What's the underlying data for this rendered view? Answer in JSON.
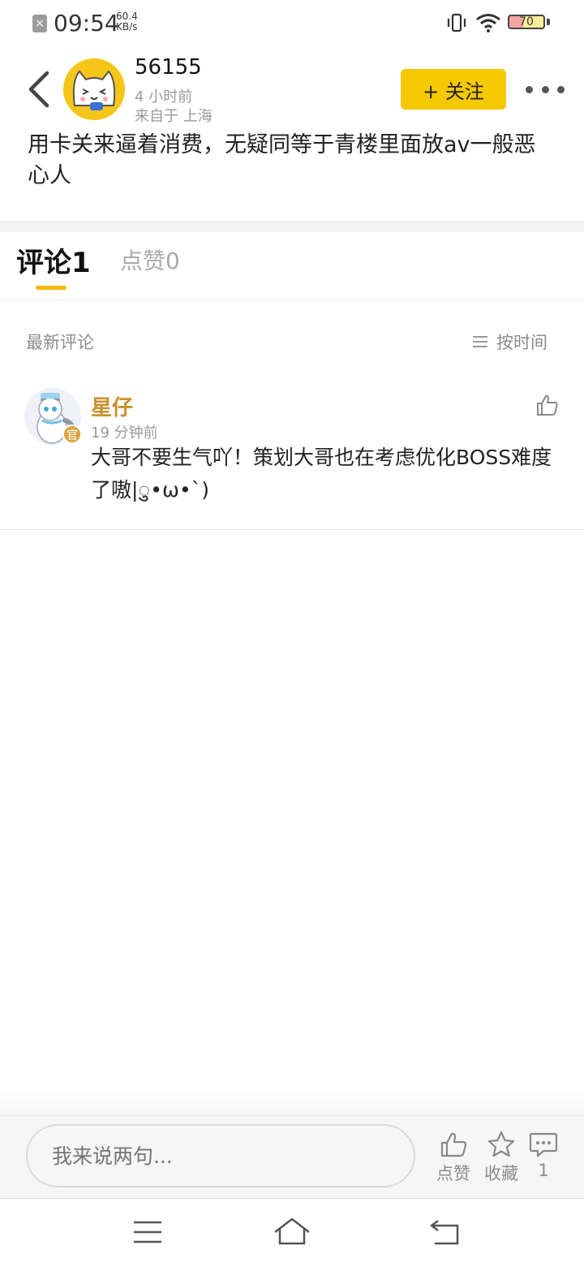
{
  "status_bar": {
    "time": "09:54",
    "net_speed_value": "60.4",
    "net_speed_unit": "KB/s",
    "battery_level": "70"
  },
  "post": {
    "author": "56155",
    "time_ago": "4 小时前",
    "location": "来自于 上海",
    "follow_label": "+ 关注",
    "content": "用卡关来逼着消费，无疑同等于青楼里面放av一般恶心人"
  },
  "tabs": [
    {
      "label": "评论1",
      "active": true
    },
    {
      "label": "点赞0",
      "active": false
    }
  ],
  "comments_header": {
    "label": "最新评论",
    "sort_label": "按时间"
  },
  "comments": [
    {
      "name": "星仔",
      "badge": "官",
      "time_ago": "19 分钟前",
      "text": "大哥不要生气吖！策划大哥也在考虑优化BOSS难度了嗷|ु•ω•`)"
    }
  ],
  "bottom_bar": {
    "input_placeholder": "我来说两句...",
    "like_label": "点赞",
    "collect_label": "收藏",
    "comment_count": "1"
  },
  "icons": {
    "back": "back-arrow-icon",
    "more": "more-dots-icon",
    "sort": "list-icon",
    "like": "thumbs-up-icon",
    "collect": "star-icon",
    "comment": "chat-bubble-icon",
    "nav_menu": "menu-icon",
    "nav_home": "home-icon",
    "nav_back": "return-icon"
  },
  "colors": {
    "accent": "#f5c800",
    "tab_underline": "#f2b600",
    "commenter_name": "#c98f2a",
    "official_badge": "#d9a441"
  }
}
